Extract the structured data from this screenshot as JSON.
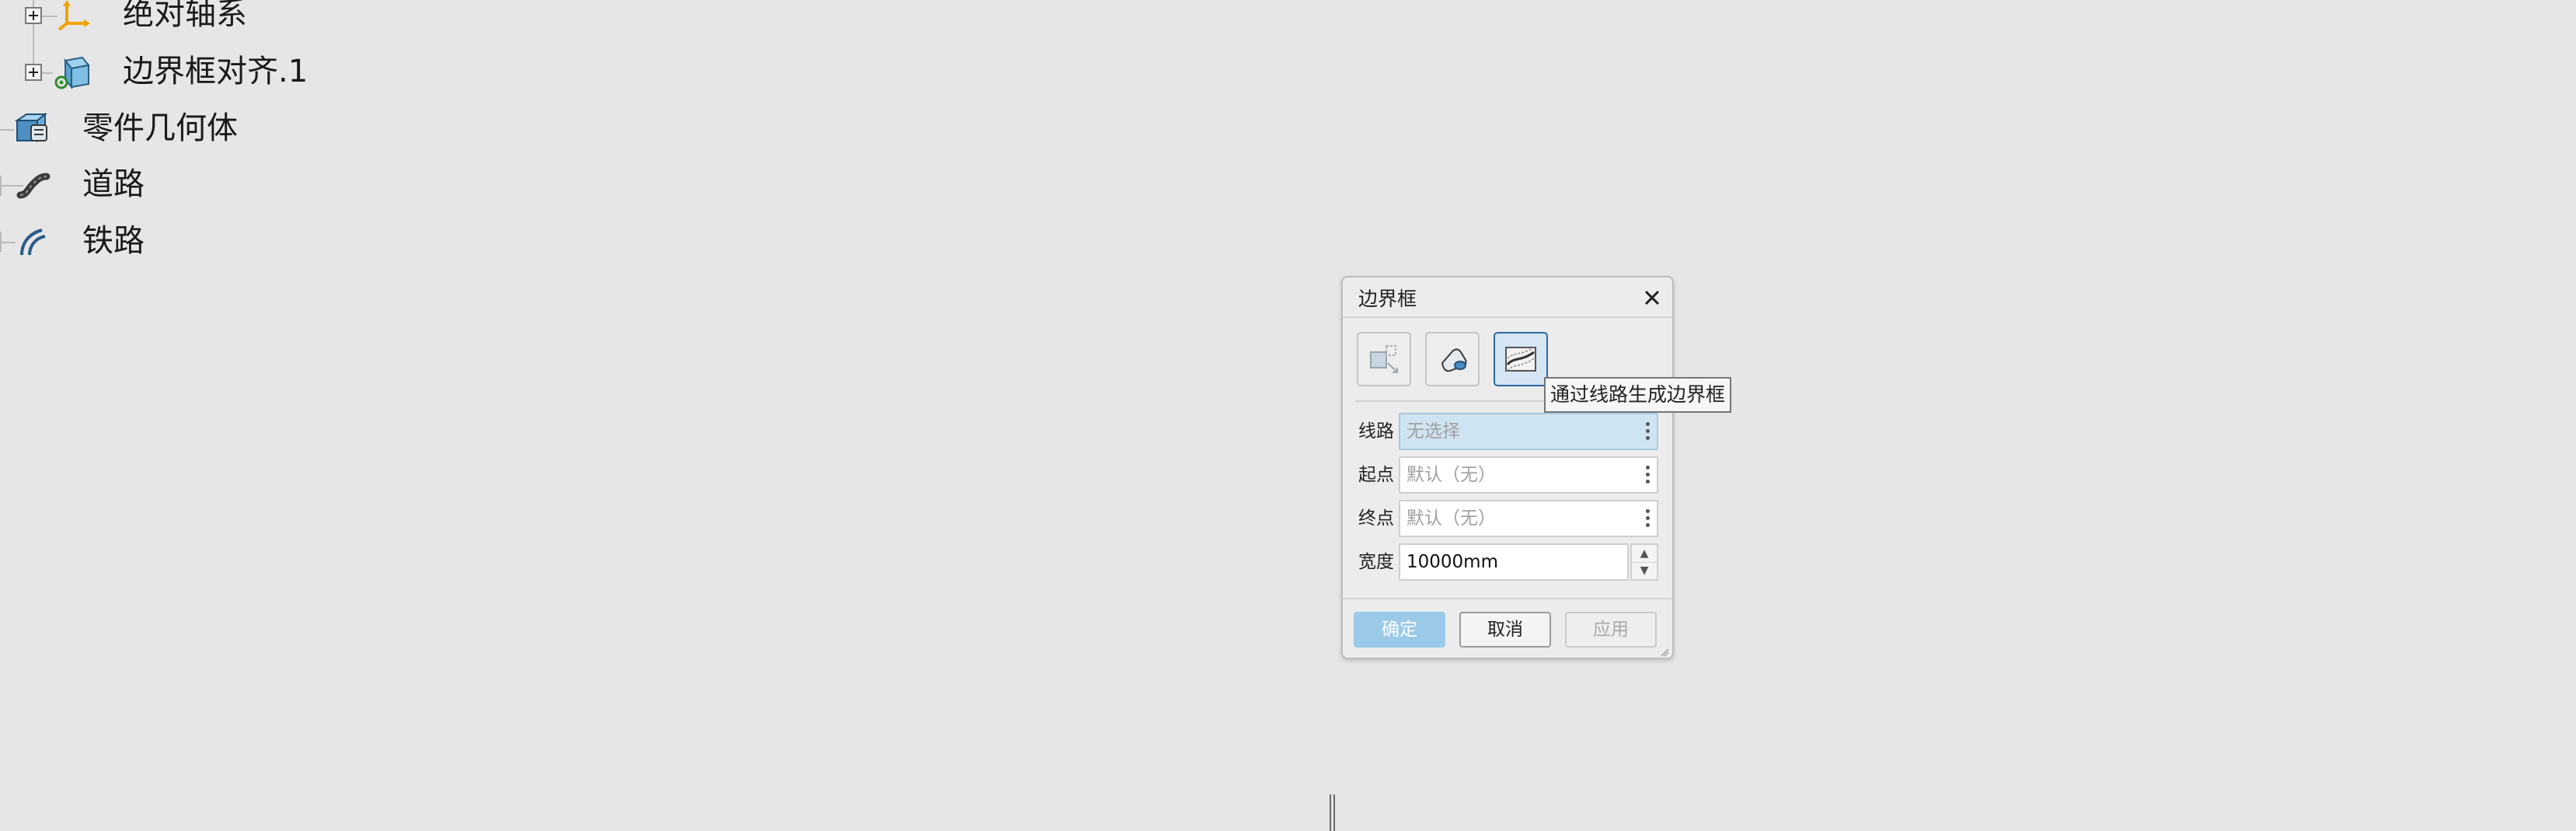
{
  "tree": {
    "items": [
      {
        "label": "绝对轴系",
        "icon": "axis-system-icon",
        "expandable": true
      },
      {
        "label": "边界框对齐.1",
        "icon": "bounding-box-align-icon",
        "expandable": true
      },
      {
        "label": "零件几何体",
        "icon": "part-geometry-icon",
        "expandable": false
      },
      {
        "label": "道路",
        "icon": "road-icon",
        "expandable": true
      },
      {
        "label": "铁路",
        "icon": "railway-icon",
        "expandable": true
      }
    ]
  },
  "dialog": {
    "title": "边界框",
    "modes": [
      {
        "icon": "box-from-selection-icon",
        "state": "disabled"
      },
      {
        "icon": "box-from-object-icon",
        "state": "normal"
      },
      {
        "icon": "box-from-route-icon",
        "state": "active"
      }
    ],
    "tooltip": "通过线路生成边界框",
    "fields": {
      "route": {
        "label": "线路",
        "placeholder": "无选择"
      },
      "start": {
        "label": "起点",
        "placeholder": "默认（无）"
      },
      "end": {
        "label": "终点",
        "placeholder": "默认（无）"
      },
      "width": {
        "label": "宽度",
        "value": "10000mm"
      }
    },
    "buttons": {
      "ok": "确定",
      "cancel": "取消",
      "apply": "应用"
    }
  },
  "colors": {
    "background": "#e6e6e6",
    "accent": "#2c6aa6",
    "selection": "#cfe4f2",
    "ok_button": "#9bc9e8",
    "axis_icon": "#f0a400"
  }
}
